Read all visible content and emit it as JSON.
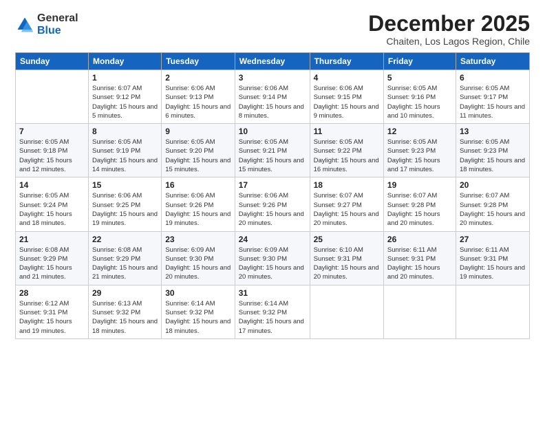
{
  "header": {
    "logo_general": "General",
    "logo_blue": "Blue",
    "month": "December 2025",
    "location": "Chaiten, Los Lagos Region, Chile"
  },
  "weekdays": [
    "Sunday",
    "Monday",
    "Tuesday",
    "Wednesday",
    "Thursday",
    "Friday",
    "Saturday"
  ],
  "weeks": [
    [
      {
        "day": "",
        "sunrise": "",
        "sunset": "",
        "daylight": ""
      },
      {
        "day": "1",
        "sunrise": "Sunrise: 6:07 AM",
        "sunset": "Sunset: 9:12 PM",
        "daylight": "Daylight: 15 hours and 5 minutes."
      },
      {
        "day": "2",
        "sunrise": "Sunrise: 6:06 AM",
        "sunset": "Sunset: 9:13 PM",
        "daylight": "Daylight: 15 hours and 6 minutes."
      },
      {
        "day": "3",
        "sunrise": "Sunrise: 6:06 AM",
        "sunset": "Sunset: 9:14 PM",
        "daylight": "Daylight: 15 hours and 8 minutes."
      },
      {
        "day": "4",
        "sunrise": "Sunrise: 6:06 AM",
        "sunset": "Sunset: 9:15 PM",
        "daylight": "Daylight: 15 hours and 9 minutes."
      },
      {
        "day": "5",
        "sunrise": "Sunrise: 6:05 AM",
        "sunset": "Sunset: 9:16 PM",
        "daylight": "Daylight: 15 hours and 10 minutes."
      },
      {
        "day": "6",
        "sunrise": "Sunrise: 6:05 AM",
        "sunset": "Sunset: 9:17 PM",
        "daylight": "Daylight: 15 hours and 11 minutes."
      }
    ],
    [
      {
        "day": "7",
        "sunrise": "Sunrise: 6:05 AM",
        "sunset": "Sunset: 9:18 PM",
        "daylight": "Daylight: 15 hours and 12 minutes."
      },
      {
        "day": "8",
        "sunrise": "Sunrise: 6:05 AM",
        "sunset": "Sunset: 9:19 PM",
        "daylight": "Daylight: 15 hours and 14 minutes."
      },
      {
        "day": "9",
        "sunrise": "Sunrise: 6:05 AM",
        "sunset": "Sunset: 9:20 PM",
        "daylight": "Daylight: 15 hours and 15 minutes."
      },
      {
        "day": "10",
        "sunrise": "Sunrise: 6:05 AM",
        "sunset": "Sunset: 9:21 PM",
        "daylight": "Daylight: 15 hours and 15 minutes."
      },
      {
        "day": "11",
        "sunrise": "Sunrise: 6:05 AM",
        "sunset": "Sunset: 9:22 PM",
        "daylight": "Daylight: 15 hours and 16 minutes."
      },
      {
        "day": "12",
        "sunrise": "Sunrise: 6:05 AM",
        "sunset": "Sunset: 9:23 PM",
        "daylight": "Daylight: 15 hours and 17 minutes."
      },
      {
        "day": "13",
        "sunrise": "Sunrise: 6:05 AM",
        "sunset": "Sunset: 9:23 PM",
        "daylight": "Daylight: 15 hours and 18 minutes."
      }
    ],
    [
      {
        "day": "14",
        "sunrise": "Sunrise: 6:05 AM",
        "sunset": "Sunset: 9:24 PM",
        "daylight": "Daylight: 15 hours and 18 minutes."
      },
      {
        "day": "15",
        "sunrise": "Sunrise: 6:06 AM",
        "sunset": "Sunset: 9:25 PM",
        "daylight": "Daylight: 15 hours and 19 minutes."
      },
      {
        "day": "16",
        "sunrise": "Sunrise: 6:06 AM",
        "sunset": "Sunset: 9:26 PM",
        "daylight": "Daylight: 15 hours and 19 minutes."
      },
      {
        "day": "17",
        "sunrise": "Sunrise: 6:06 AM",
        "sunset": "Sunset: 9:26 PM",
        "daylight": "Daylight: 15 hours and 20 minutes."
      },
      {
        "day": "18",
        "sunrise": "Sunrise: 6:07 AM",
        "sunset": "Sunset: 9:27 PM",
        "daylight": "Daylight: 15 hours and 20 minutes."
      },
      {
        "day": "19",
        "sunrise": "Sunrise: 6:07 AM",
        "sunset": "Sunset: 9:28 PM",
        "daylight": "Daylight: 15 hours and 20 minutes."
      },
      {
        "day": "20",
        "sunrise": "Sunrise: 6:07 AM",
        "sunset": "Sunset: 9:28 PM",
        "daylight": "Daylight: 15 hours and 20 minutes."
      }
    ],
    [
      {
        "day": "21",
        "sunrise": "Sunrise: 6:08 AM",
        "sunset": "Sunset: 9:29 PM",
        "daylight": "Daylight: 15 hours and 21 minutes."
      },
      {
        "day": "22",
        "sunrise": "Sunrise: 6:08 AM",
        "sunset": "Sunset: 9:29 PM",
        "daylight": "Daylight: 15 hours and 21 minutes."
      },
      {
        "day": "23",
        "sunrise": "Sunrise: 6:09 AM",
        "sunset": "Sunset: 9:30 PM",
        "daylight": "Daylight: 15 hours and 20 minutes."
      },
      {
        "day": "24",
        "sunrise": "Sunrise: 6:09 AM",
        "sunset": "Sunset: 9:30 PM",
        "daylight": "Daylight: 15 hours and 20 minutes."
      },
      {
        "day": "25",
        "sunrise": "Sunrise: 6:10 AM",
        "sunset": "Sunset: 9:31 PM",
        "daylight": "Daylight: 15 hours and 20 minutes."
      },
      {
        "day": "26",
        "sunrise": "Sunrise: 6:11 AM",
        "sunset": "Sunset: 9:31 PM",
        "daylight": "Daylight: 15 hours and 20 minutes."
      },
      {
        "day": "27",
        "sunrise": "Sunrise: 6:11 AM",
        "sunset": "Sunset: 9:31 PM",
        "daylight": "Daylight: 15 hours and 19 minutes."
      }
    ],
    [
      {
        "day": "28",
        "sunrise": "Sunrise: 6:12 AM",
        "sunset": "Sunset: 9:31 PM",
        "daylight": "Daylight: 15 hours and 19 minutes."
      },
      {
        "day": "29",
        "sunrise": "Sunrise: 6:13 AM",
        "sunset": "Sunset: 9:32 PM",
        "daylight": "Daylight: 15 hours and 18 minutes."
      },
      {
        "day": "30",
        "sunrise": "Sunrise: 6:14 AM",
        "sunset": "Sunset: 9:32 PM",
        "daylight": "Daylight: 15 hours and 18 minutes."
      },
      {
        "day": "31",
        "sunrise": "Sunrise: 6:14 AM",
        "sunset": "Sunset: 9:32 PM",
        "daylight": "Daylight: 15 hours and 17 minutes."
      },
      {
        "day": "",
        "sunrise": "",
        "sunset": "",
        "daylight": ""
      },
      {
        "day": "",
        "sunrise": "",
        "sunset": "",
        "daylight": ""
      },
      {
        "day": "",
        "sunrise": "",
        "sunset": "",
        "daylight": ""
      }
    ]
  ]
}
